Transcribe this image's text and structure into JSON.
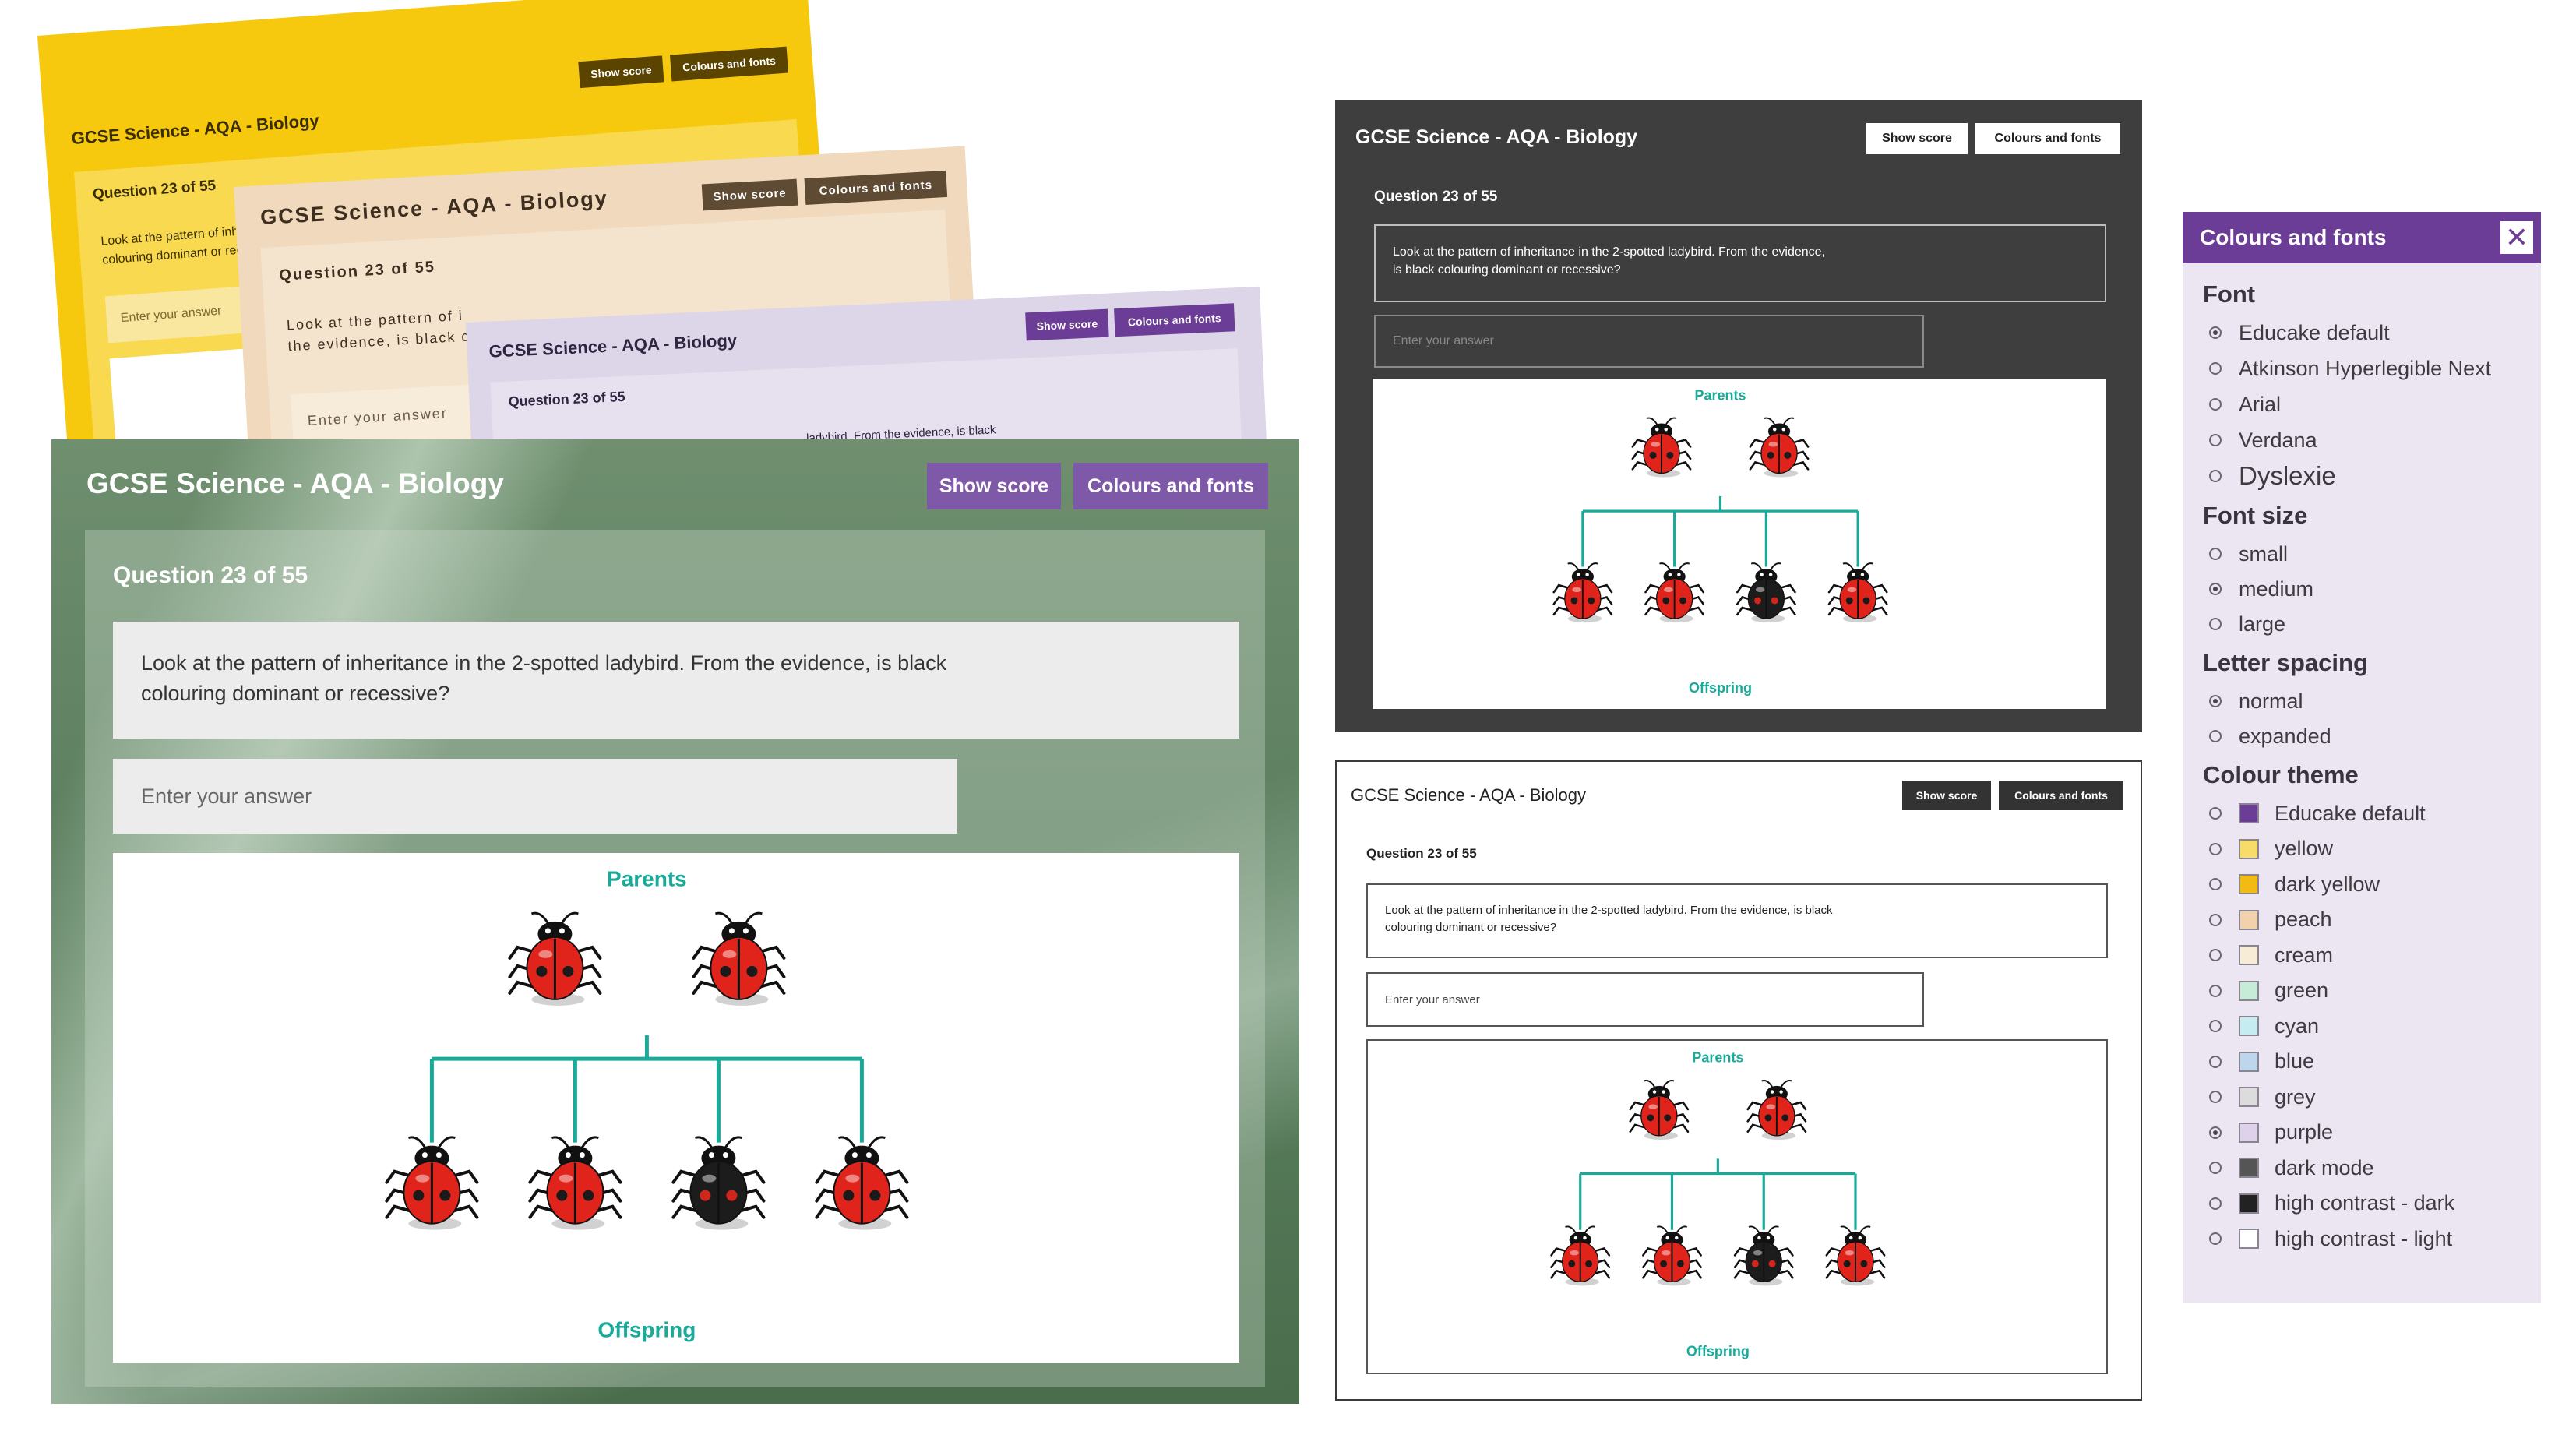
{
  "app": {
    "title": "GCSE Science - AQA - Biology",
    "show_score": "Show score",
    "colours_fonts": "Colours and fonts",
    "question_label": "Question 23 of 55",
    "question_text": "Look at the pattern of inheritance in the 2-spotted ladybird. From the evidence, is black colouring dominant or recessive?",
    "question_line1": "Look at the pattern of inheritance in the 2-spotted ladybird. From the evidence, is black",
    "question_line2": "colouring dominant or recessive?",
    "dark_line1": "Look at the pattern of inheritance in the 2-spotted ladybird. From the evidence,",
    "dark_line2": "is black colouring dominant or recessive?",
    "frag_line1": "Look at the pattern of inhe",
    "frag_line2": "colouring dominant or rece",
    "frag_peach1": "Look at the pattern of i",
    "frag_peach2": "the evidence, is black c",
    "frag_purple": "ladybird. From the evidence, is black",
    "answer_placeholder": "Enter your answer"
  },
  "diagram": {
    "parents_label": "Parents",
    "offspring_label": "Offspring",
    "parents": [
      "red",
      "red"
    ],
    "offspring": [
      "red",
      "red",
      "black",
      "red"
    ]
  },
  "colors": {
    "yellow": "#f6c90e",
    "peach": "#f0d9bc",
    "purple_theme": "#ddd5e8",
    "dark": "#3e3e3e",
    "accent_purple": "#6c3d97",
    "teal": "#1aaa9a",
    "ladybird_red": "#e0241b"
  },
  "panel": {
    "title": "Colours and fonts",
    "close_icon": "close-icon",
    "font_heading": "Font",
    "fonts": [
      {
        "label": "Educake default",
        "selected": true
      },
      {
        "label": "Atkinson Hyperlegible Next",
        "selected": false
      },
      {
        "label": "Arial",
        "selected": false
      },
      {
        "label": "Verdana",
        "selected": false
      },
      {
        "label": "Dyslexie",
        "selected": false
      }
    ],
    "size_heading": "Font size",
    "sizes": [
      {
        "label": "small",
        "selected": false
      },
      {
        "label": "medium",
        "selected": true
      },
      {
        "label": "large",
        "selected": false
      }
    ],
    "spacing_heading": "Letter spacing",
    "spacings": [
      {
        "label": "normal",
        "selected": true
      },
      {
        "label": "expanded",
        "selected": false
      }
    ],
    "theme_heading": "Colour theme",
    "themes": [
      {
        "label": "Educake default",
        "color": "#6c3d97",
        "selected": false
      },
      {
        "label": "yellow",
        "color": "#f8dc6a",
        "selected": false
      },
      {
        "label": "dark yellow",
        "color": "#f2bb14",
        "selected": false
      },
      {
        "label": "peach",
        "color": "#f1d2ad",
        "selected": false
      },
      {
        "label": "cream",
        "color": "#f7ecd6",
        "selected": false
      },
      {
        "label": "green",
        "color": "#c6ecd8",
        "selected": false
      },
      {
        "label": "cyan",
        "color": "#c4ecf1",
        "selected": false
      },
      {
        "label": "blue",
        "color": "#bed6ec",
        "selected": false
      },
      {
        "label": "grey",
        "color": "#dcdcdc",
        "selected": false
      },
      {
        "label": "purple",
        "color": "#ddd2ea",
        "selected": true
      },
      {
        "label": "dark mode",
        "color": "#555555",
        "selected": false
      },
      {
        "label": "high contrast - dark",
        "color": "#222222",
        "selected": false
      },
      {
        "label": "high contrast - light",
        "color": "#ffffff",
        "selected": false
      }
    ]
  }
}
